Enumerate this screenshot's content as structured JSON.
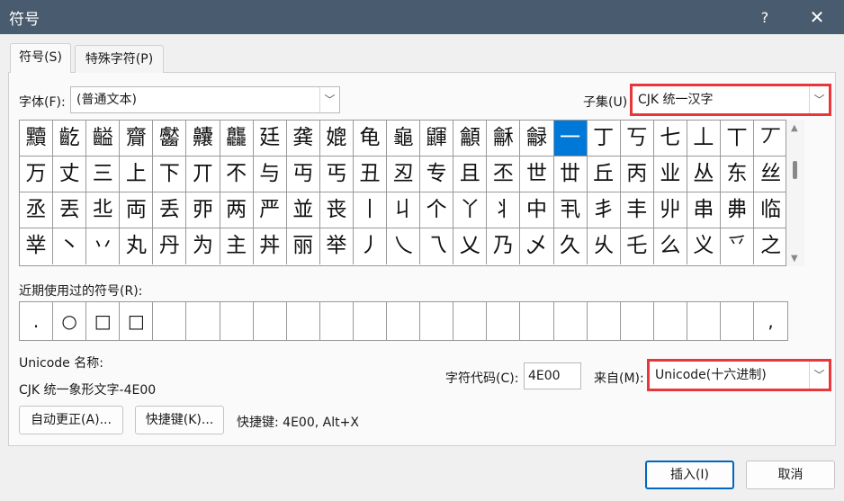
{
  "window": {
    "title": "符号",
    "help": "?",
    "close": "✕"
  },
  "tabs": [
    {
      "label": "符号(S)"
    },
    {
      "label": "特殊字符(P)"
    }
  ],
  "font": {
    "label": "字体(F):",
    "value": "(普通文本)"
  },
  "subset": {
    "label": "子集(U)",
    "value": "CJK 统一汉字"
  },
  "grid": {
    "rows": [
      [
        "黷",
        "齕",
        "齸",
        "齎",
        "齾",
        "齉",
        "龘",
        "廷",
        "龚",
        "媲",
        "龟",
        "龜",
        "鼲",
        "龥",
        "龢",
        "龣",
        "一",
        "丁",
        "丂",
        "七",
        "丄",
        "丅",
        "丆"
      ],
      [
        "万",
        "丈",
        "三",
        "上",
        "下",
        "丌",
        "不",
        "与",
        "丏",
        "丐",
        "丑",
        "丒",
        "专",
        "且",
        "丕",
        "世",
        "丗",
        "丘",
        "丙",
        "业",
        "丛",
        "东",
        "丝"
      ],
      [
        "丞",
        "丟",
        "丠",
        "両",
        "丢",
        "丣",
        "两",
        "严",
        "並",
        "丧",
        "丨",
        "丩",
        "个",
        "丫",
        "丬",
        "中",
        "丮",
        "丯",
        "丰",
        "丱",
        "串",
        "丳",
        "临"
      ],
      [
        "丵",
        "丶",
        "丷",
        "丸",
        "丹",
        "为",
        "主",
        "丼",
        "丽",
        "举",
        "丿",
        "乀",
        "乁",
        "乂",
        "乃",
        "乄",
        "久",
        "乆",
        "乇",
        "么",
        "义",
        "乊",
        "之"
      ]
    ],
    "selected_row": 0,
    "selected_col": 16
  },
  "recent": {
    "label": "近期使用过的符号(R):",
    "items": [
      ".",
      "○",
      "□",
      "□",
      "",
      "",
      "",
      "",
      "",
      "",
      "",
      "",
      "",
      "",
      "",
      "",
      "",
      "",
      "",
      "",
      "",
      "",
      ","
    ]
  },
  "unicode_name": {
    "label": "Unicode 名称:",
    "value": "CJK 统一象形文字-4E00"
  },
  "char_code": {
    "label": "字符代码(C):",
    "value": "4E00"
  },
  "from": {
    "label": "来自(M):",
    "value": "Unicode(十六进制)"
  },
  "buttons": {
    "autocorrect": "自动更正(A)...",
    "shortcut_key": "快捷键(K)...",
    "shortcut_info": "快捷键: 4E00, Alt+X",
    "insert": "插入(I)",
    "cancel": "取消"
  },
  "colors": {
    "titlebar": "#495b6e",
    "selection": "#0078d7",
    "highlight": "#e8363b",
    "primary_border": "#0067c0"
  }
}
